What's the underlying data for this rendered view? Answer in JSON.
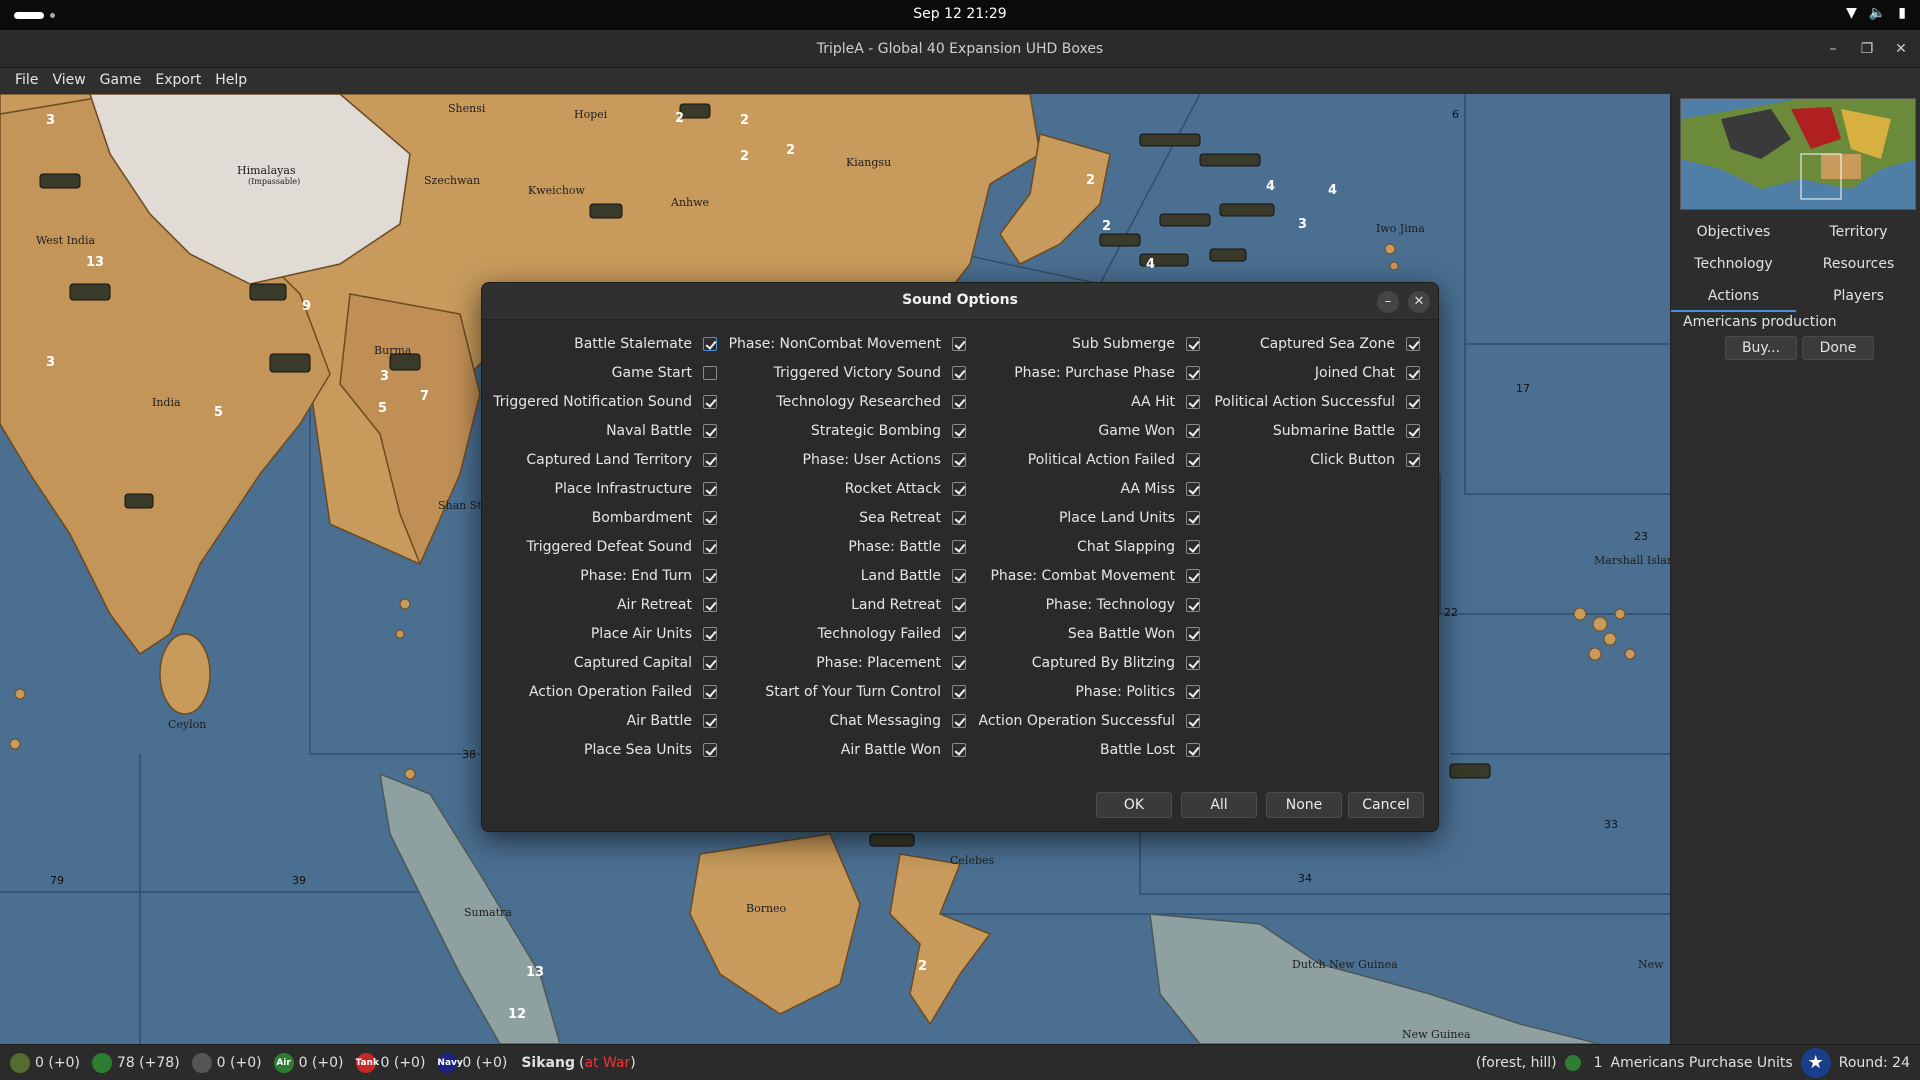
{
  "topbar": {
    "clock": "Sep 12  21:29"
  },
  "window": {
    "title": "TripleA - Global 40 Expansion UHD Boxes"
  },
  "menu": [
    "File",
    "View",
    "Game",
    "Export",
    "Help"
  ],
  "map": {
    "territories": [
      "Shensi",
      "Hopei",
      "Himalayas",
      "(Impassable)",
      "Szechwan",
      "Kweichow",
      "Anhwe",
      "Kiangsu",
      "West India",
      "India",
      "Burma",
      "Shan State",
      "Ceylon",
      "Sumatra",
      "Borneo",
      "Celebes",
      "Dutch New Guinea",
      "New Guinea",
      "Iwo Jima",
      "Marshall Islands",
      "New"
    ],
    "zones": [
      "6",
      "17",
      "23",
      "22",
      "38",
      "79",
      "39",
      "34",
      "33"
    ],
    "unit_counts": [
      "3",
      "2",
      "2",
      "2",
      "2",
      "13",
      "3",
      "9",
      "5",
      "7",
      "3",
      "5",
      "2",
      "2",
      "4",
      "4",
      "3",
      "4",
      "2",
      "13",
      "12"
    ]
  },
  "sidepanel": {
    "tabs_row1": [
      "Objectives",
      "Territory"
    ],
    "tabs_row2": [
      "Technology",
      "Resources"
    ],
    "tabs_row3": [
      "Actions",
      "Players"
    ],
    "production_label": "Americans production",
    "buy_button": "Buy...",
    "done_button": "Done"
  },
  "dialog": {
    "title": "Sound Options",
    "columns": [
      [
        {
          "label": "Battle Stalemate",
          "checked": true
        },
        {
          "label": "Game Start",
          "checked": false
        },
        {
          "label": "Triggered Notification Sound",
          "checked": true
        },
        {
          "label": "Naval Battle",
          "checked": true
        },
        {
          "label": "Captured Land Territory",
          "checked": true
        },
        {
          "label": "Place Infrastructure",
          "checked": true
        },
        {
          "label": "Bombardment",
          "checked": true
        },
        {
          "label": "Triggered Defeat Sound",
          "checked": true
        },
        {
          "label": "Phase: End Turn",
          "checked": true
        },
        {
          "label": "Air Retreat",
          "checked": true
        },
        {
          "label": "Place Air Units",
          "checked": true
        },
        {
          "label": "Captured Capital",
          "checked": true
        },
        {
          "label": "Action Operation Failed",
          "checked": true
        },
        {
          "label": "Air Battle",
          "checked": true
        },
        {
          "label": "Place Sea Units",
          "checked": true
        }
      ],
      [
        {
          "label": "Phase: NonCombat Movement",
          "checked": true
        },
        {
          "label": "Triggered Victory Sound",
          "checked": true
        },
        {
          "label": "Technology Researched",
          "checked": true
        },
        {
          "label": "Strategic Bombing",
          "checked": true
        },
        {
          "label": "Phase: User Actions",
          "checked": true
        },
        {
          "label": "Rocket Attack",
          "checked": true
        },
        {
          "label": "Sea Retreat",
          "checked": true
        },
        {
          "label": "Phase: Battle",
          "checked": true
        },
        {
          "label": "Land Battle",
          "checked": true
        },
        {
          "label": "Land Retreat",
          "checked": true
        },
        {
          "label": "Technology Failed",
          "checked": true
        },
        {
          "label": "Phase: Placement",
          "checked": true
        },
        {
          "label": "Start of Your Turn Control",
          "checked": true
        },
        {
          "label": "Chat Messaging",
          "checked": true
        },
        {
          "label": "Air Battle Won",
          "checked": true
        }
      ],
      [
        {
          "label": "Sub Submerge",
          "checked": true
        },
        {
          "label": "Phase: Purchase Phase",
          "checked": true
        },
        {
          "label": "AA Hit",
          "checked": true
        },
        {
          "label": "Game Won",
          "checked": true
        },
        {
          "label": "Political Action Failed",
          "checked": true
        },
        {
          "label": "AA Miss",
          "checked": true
        },
        {
          "label": "Place Land Units",
          "checked": true
        },
        {
          "label": "Chat Slapping",
          "checked": true
        },
        {
          "label": "Phase: Combat Movement",
          "checked": true
        },
        {
          "label": "Phase: Technology",
          "checked": true
        },
        {
          "label": "Sea Battle Won",
          "checked": true
        },
        {
          "label": "Captured By Blitzing",
          "checked": true
        },
        {
          "label": "Phase: Politics",
          "checked": true
        },
        {
          "label": "Action Operation Successful",
          "checked": true
        },
        {
          "label": "Battle Lost",
          "checked": true
        }
      ],
      [
        {
          "label": "Captured Sea Zone",
          "checked": true
        },
        {
          "label": "Joined Chat",
          "checked": true
        },
        {
          "label": "Political Action Successful",
          "checked": true
        },
        {
          "label": "Submarine Battle",
          "checked": true
        },
        {
          "label": "Click Button",
          "checked": true
        }
      ]
    ],
    "buttons": {
      "ok": "OK",
      "all": "All",
      "none": "None",
      "cancel": "Cancel"
    }
  },
  "statusbar": {
    "infantry": "0 (+0)",
    "pus": "78 (+78)",
    "tech": "0 (+0)",
    "air": "0 (+0)",
    "tank": "0 (+0)",
    "navy": "0 (+0)",
    "icon_air": "Air",
    "icon_tank": "Tank",
    "icon_navy": "Navy",
    "territory": "Sikang",
    "status": "at War",
    "terrain": "(forest, hill)",
    "purchase_count": "1",
    "purchase_text": "Americans Purchase Units",
    "round": "Round: 24"
  }
}
